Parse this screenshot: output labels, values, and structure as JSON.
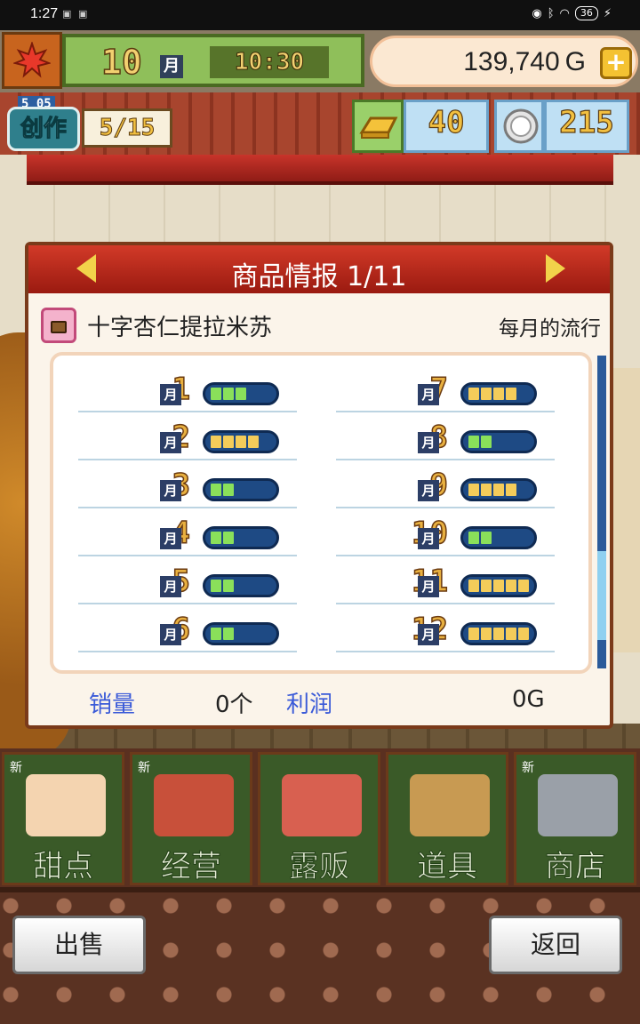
{
  "status_bar": {
    "time": "1:27",
    "battery": "36"
  },
  "hud": {
    "month_num": "10",
    "month_unit": "月",
    "clock": "10:30",
    "gold": "139,740 G",
    "gold_plus": "+",
    "create_label": "创作",
    "create_sub": "5 05",
    "create_count": "5/15",
    "gold_bars": "40",
    "medals": "215"
  },
  "panel": {
    "title": "商品情报 1/11",
    "item_name": "十字杏仁提拉米苏",
    "trend_label": "每月的流行",
    "unit": "月",
    "months_left": [
      {
        "num": "1",
        "level": 3,
        "color": "green"
      },
      {
        "num": "2",
        "level": 4,
        "color": "yellow"
      },
      {
        "num": "3",
        "level": 2,
        "color": "green"
      },
      {
        "num": "4",
        "level": 2,
        "color": "green"
      },
      {
        "num": "5",
        "level": 2,
        "color": "green"
      },
      {
        "num": "6",
        "level": 2,
        "color": "green"
      }
    ],
    "months_right": [
      {
        "num": "7",
        "level": 4,
        "color": "yellow"
      },
      {
        "num": "8",
        "level": 2,
        "color": "green"
      },
      {
        "num": "9",
        "level": 4,
        "color": "yellow"
      },
      {
        "num": "10",
        "level": 2,
        "color": "green"
      },
      {
        "num": "11",
        "level": 5,
        "color": "yellow"
      },
      {
        "num": "12",
        "level": 5,
        "color": "yellow"
      }
    ],
    "sales_label": "销量",
    "sales_value": "0个",
    "profit_label": "利润",
    "profit_value": "0G"
  },
  "menu": {
    "new_tag": "新",
    "items": [
      {
        "label": "甜点",
        "new": true,
        "color": "#f4d4b0"
      },
      {
        "label": "经营",
        "new": true,
        "color": "#c8503a"
      },
      {
        "label": "露贩",
        "new": false,
        "color": "#d86050"
      },
      {
        "label": "道具",
        "new": false,
        "color": "#c89a52"
      },
      {
        "label": "商店",
        "new": true,
        "color": "#9aa0a8"
      }
    ]
  },
  "buttons": {
    "sell": "出售",
    "back": "返回"
  },
  "colors": {
    "gauge_green": "#8ae05a",
    "gauge_yellow": "#f4cc5a",
    "panel_header": "#c22e20",
    "link_blue": "#3a5ad8"
  }
}
